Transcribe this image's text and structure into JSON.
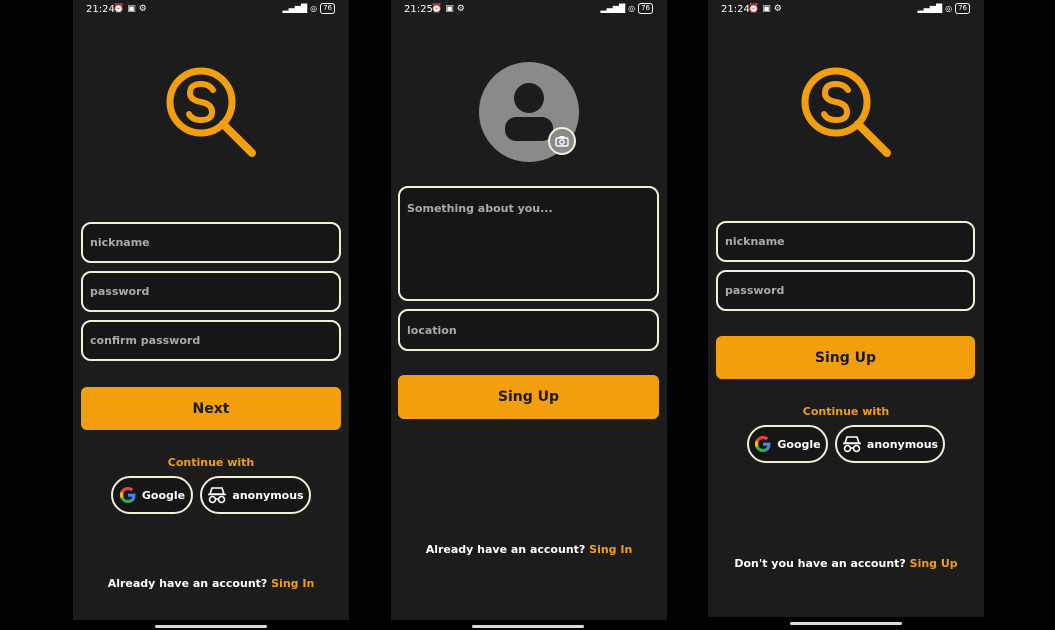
{
  "colors": {
    "accent": "#f39f0d",
    "background": "#1c1c1c",
    "field_border": "#f1efd6"
  },
  "screen1": {
    "status": {
      "time": "21:24",
      "battery": "76"
    },
    "fields": [
      {
        "placeholder": "nickname"
      },
      {
        "placeholder": "password"
      },
      {
        "placeholder": "confirm password"
      }
    ],
    "next_label": "Next",
    "continue_with": "Continue with",
    "google_label": "Google",
    "anonymous_label": "anonymous",
    "footer_text": "Already have an account?",
    "footer_link": "Sing In"
  },
  "screen2": {
    "status": {
      "time": "21:25",
      "battery": "76"
    },
    "about_placeholder": "Something about you...",
    "location_placeholder": "location",
    "signup_label": "Sing Up",
    "footer_text": "Already have an account?",
    "footer_link": "Sing In"
  },
  "screen3": {
    "status": {
      "time": "21:24",
      "battery": "76"
    },
    "fields": [
      {
        "placeholder": "nickname"
      },
      {
        "placeholder": "password"
      }
    ],
    "signup_label": "Sing Up",
    "continue_with": "Continue with",
    "google_label": "Google",
    "anonymous_label": "anonymous",
    "footer_text": "Don't you have an account?",
    "footer_link": "Sing Up"
  }
}
